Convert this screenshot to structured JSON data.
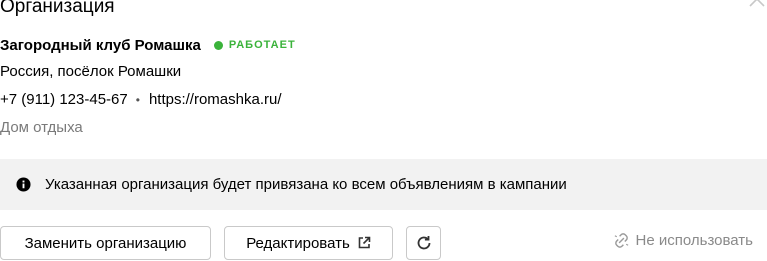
{
  "section": {
    "title": "Организация"
  },
  "organization": {
    "name": "Загородный клуб Ромашка",
    "status": "РАБОТАЕТ",
    "address": "Россия, посёлок Ромашки",
    "phone": "+7 (911) 123-45-67",
    "separator": "•",
    "website": "https://romashka.ru/",
    "category": "Дом отдыха"
  },
  "info": {
    "text": "Указанная организация будет привязана ко всем объявлениям в кампании"
  },
  "actions": {
    "replace_label": "Заменить организацию",
    "edit_label": "Редактировать",
    "unlink_label": "Не использовать"
  },
  "icons": {
    "collapse": "chevron-up-icon",
    "info": "info-icon",
    "external": "external-link-icon",
    "refresh": "refresh-icon",
    "unlink": "unlink-icon"
  },
  "colors": {
    "status_green": "#3bb33b",
    "info_background": "#f2f2f2",
    "muted_text": "#7a7a7a",
    "button_border": "#c9c9c9"
  }
}
